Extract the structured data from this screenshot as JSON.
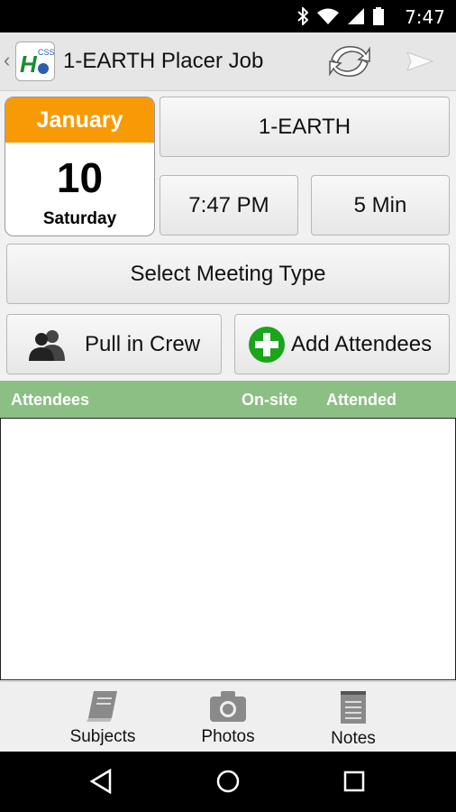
{
  "status_bar": {
    "time": "7:47"
  },
  "app_bar": {
    "logo_text": "CSS",
    "title": "1-EARTH Placer Job"
  },
  "calendar": {
    "month": "January",
    "day": "10",
    "weekday": "Saturday"
  },
  "buttons": {
    "company": "1-EARTH",
    "time": "7:47 PM",
    "duration": "5 Min",
    "meeting_type": "Select Meeting Type",
    "pull_crew": "Pull in Crew",
    "add_attendees": "Add Attendees"
  },
  "attendees_header": {
    "attendees": "Attendees",
    "onsite": "On-site",
    "attended": "Attended"
  },
  "tabs": [
    {
      "label": "Subjects",
      "icon": "book-icon"
    },
    {
      "label": "Photos",
      "icon": "camera-icon"
    },
    {
      "label": "Notes",
      "icon": "notepad-icon"
    }
  ],
  "colors": {
    "accent_orange": "#f89a05",
    "header_green": "#8bbf83",
    "add_green": "#1aa51a"
  }
}
